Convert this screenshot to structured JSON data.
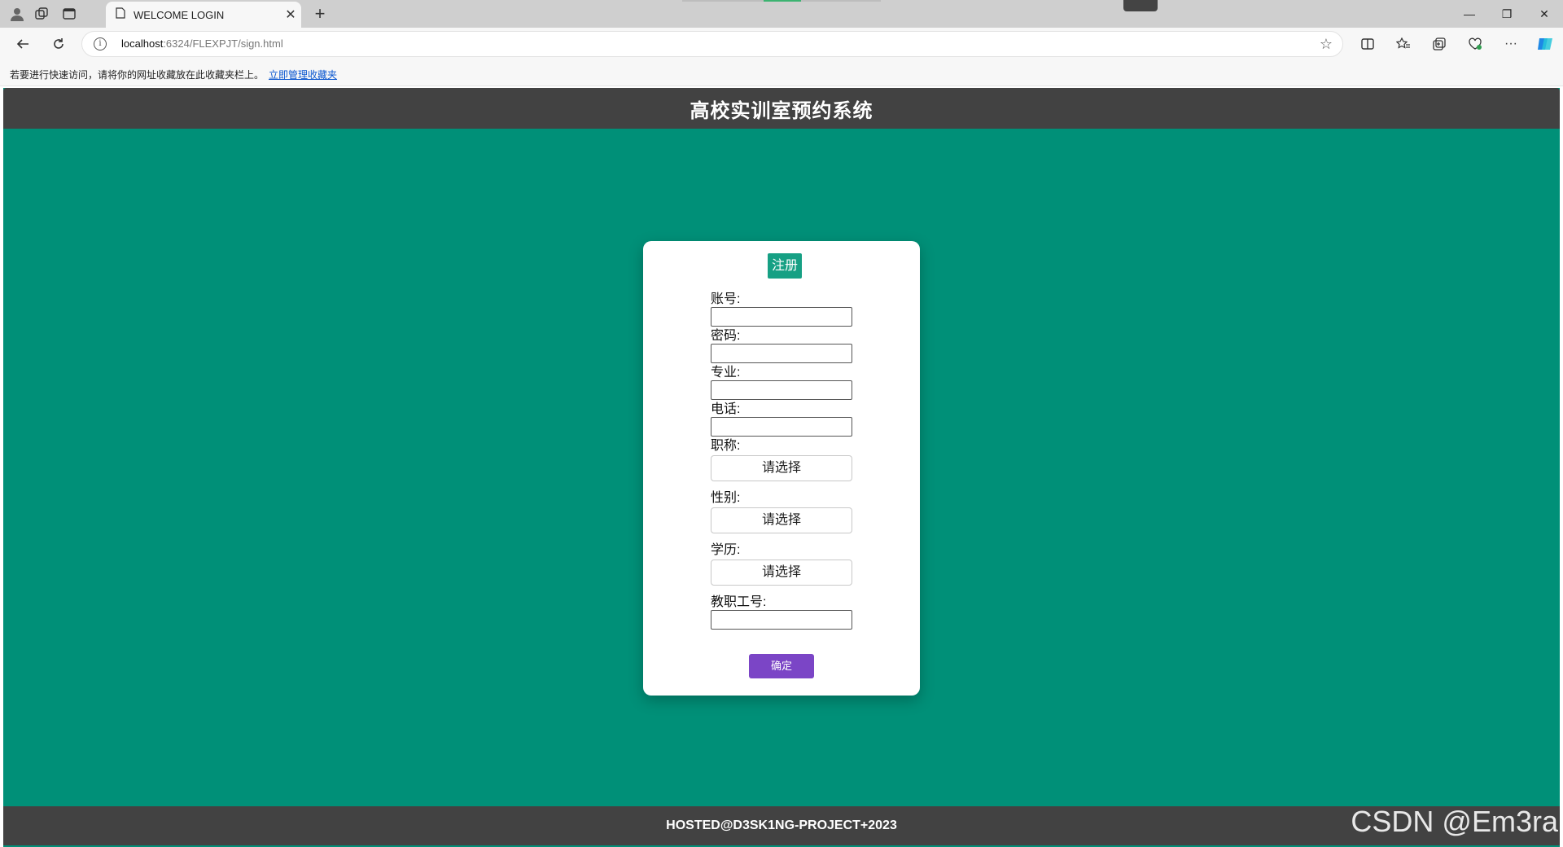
{
  "browser": {
    "tab_title": "WELCOME LOGIN",
    "tab_close": "✕",
    "new_tab": "+",
    "address_host": "localhost",
    "address_rest": ":6324/FLEXPJT/sign.html",
    "favorites_hint": "若要进行快速访问，请将你的网址收藏放在此收藏夹栏上。",
    "favorites_link": "立即管理收藏夹",
    "window_minimize": "—",
    "window_restore": "❐",
    "window_close": "✕"
  },
  "header": {
    "title": "高校实训室预约系统"
  },
  "form": {
    "title": "注册",
    "fields": {
      "account_label": "账号:",
      "password_label": "密码:",
      "major_label": "专业:",
      "phone_label": "电话:",
      "title_label": "职称:",
      "title_select": "请选择",
      "gender_label": "性别:",
      "gender_select": "请选择",
      "education_label": "学历:",
      "education_select": "请选择",
      "staff_id_label": "教职工号:"
    },
    "submit_label": "确定"
  },
  "footer": {
    "text": "HOSTED@D3SK1NG-PROJECT+2023"
  },
  "watermark": "CSDN @Em3ra",
  "colors": {
    "page_bg": "#009078",
    "bar_bg": "#424242",
    "title_badge": "#16a084",
    "submit_bg": "#7b45c6"
  }
}
